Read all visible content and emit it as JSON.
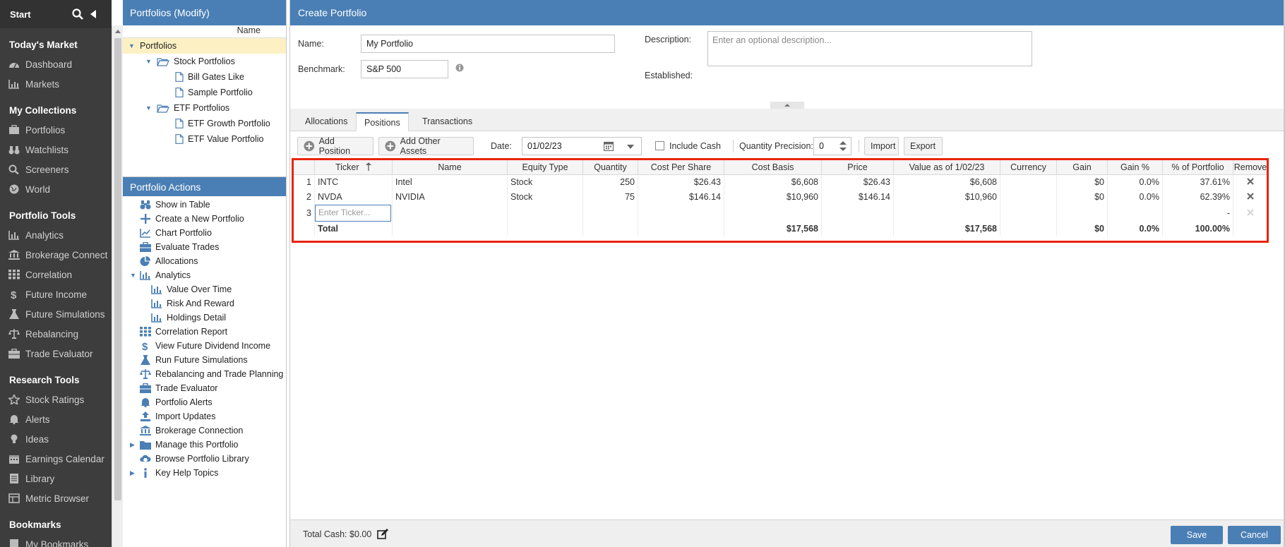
{
  "nav": {
    "start_label": "Start",
    "sections": [
      {
        "title": "Today's Market",
        "items": [
          {
            "label": "Dashboard",
            "icon": "dashboard-icon"
          },
          {
            "label": "Markets",
            "icon": "markets-icon"
          }
        ]
      },
      {
        "title": "My Collections",
        "items": [
          {
            "label": "Portfolios",
            "icon": "portfolios-icon"
          },
          {
            "label": "Watchlists",
            "icon": "watchlists-icon"
          },
          {
            "label": "Screeners",
            "icon": "screeners-icon"
          },
          {
            "label": "World",
            "icon": "world-icon"
          }
        ]
      },
      {
        "title": "Portfolio Tools",
        "items": [
          {
            "label": "Analytics",
            "icon": "analytics-icon"
          },
          {
            "label": "Brokerage Connect",
            "icon": "bank-icon"
          },
          {
            "label": "Correlation",
            "icon": "grid-icon"
          },
          {
            "label": "Future Income",
            "icon": "dollar-icon"
          },
          {
            "label": "Future Simulations",
            "icon": "flask-icon"
          },
          {
            "label": "Rebalancing",
            "icon": "scale-icon"
          },
          {
            "label": "Trade Evaluator",
            "icon": "briefcase-icon"
          }
        ]
      },
      {
        "title": "Research Tools",
        "items": [
          {
            "label": "Stock Ratings",
            "icon": "star-icon"
          },
          {
            "label": "Alerts",
            "icon": "bell-icon"
          },
          {
            "label": "Ideas",
            "icon": "bulb-icon"
          },
          {
            "label": "Earnings Calendar",
            "icon": "calendar-icon"
          },
          {
            "label": "Library",
            "icon": "library-icon"
          },
          {
            "label": "Metric Browser",
            "icon": "metric-icon"
          }
        ]
      },
      {
        "title": "Bookmarks",
        "items": [
          {
            "label": "My Bookmarks",
            "icon": "bookmark-icon"
          }
        ]
      }
    ]
  },
  "tree": {
    "title": "Portfolios (Modify)",
    "column": "Name",
    "nodes": [
      {
        "label": "Portfolios",
        "level": 0,
        "type": "root",
        "selected": true
      },
      {
        "label": "Stock Portfolios",
        "level": 1,
        "type": "folder"
      },
      {
        "label": "Bill Gates Like",
        "level": 2,
        "type": "file"
      },
      {
        "label": "Sample Portfolio",
        "level": 2,
        "type": "file"
      },
      {
        "label": "ETF Portfolios",
        "level": 1,
        "type": "folder"
      },
      {
        "label": "ETF Growth Portfolio",
        "level": 2,
        "type": "file"
      },
      {
        "label": "ETF Value Portfolio",
        "level": 2,
        "type": "file"
      }
    ]
  },
  "actions": {
    "title": "Portfolio Actions",
    "items": [
      {
        "label": "Show in Table",
        "icon": "binoculars-icon",
        "indent": 0
      },
      {
        "label": "Create a New Portfolio",
        "icon": "plus-icon",
        "indent": 0
      },
      {
        "label": "Chart Portfolio",
        "icon": "line-chart-icon",
        "indent": 0
      },
      {
        "label": "Evaluate Trades",
        "icon": "briefcase-icon",
        "indent": 0
      },
      {
        "label": "Allocations",
        "icon": "pie-icon",
        "indent": 0
      },
      {
        "label": "Analytics",
        "icon": "analytics-icon",
        "indent": 0,
        "expanded": true
      },
      {
        "label": "Value Over Time",
        "icon": "bar-chart-icon",
        "indent": 1
      },
      {
        "label": "Risk And Reward",
        "icon": "bar-chart-icon",
        "indent": 1
      },
      {
        "label": "Holdings Detail",
        "icon": "bar-chart-icon",
        "indent": 1
      },
      {
        "label": "Correlation Report",
        "icon": "grid-icon",
        "indent": 0
      },
      {
        "label": "View Future Dividend Income",
        "icon": "dollar-icon",
        "indent": 0
      },
      {
        "label": "Run Future Simulations",
        "icon": "flask-icon",
        "indent": 0
      },
      {
        "label": "Rebalancing and Trade Planning",
        "icon": "scale-icon",
        "indent": 0
      },
      {
        "label": "Trade Evaluator",
        "icon": "briefcase-icon",
        "indent": 0
      },
      {
        "label": "Portfolio Alerts",
        "icon": "bell-icon",
        "indent": 0
      },
      {
        "label": "Import Updates",
        "icon": "upload-icon",
        "indent": 0
      },
      {
        "label": "Brokerage Connection",
        "icon": "bank-icon",
        "indent": 0
      },
      {
        "label": "Manage this Portfolio",
        "icon": "folder-icon",
        "indent": 0,
        "collapsed": true
      },
      {
        "label": "Browse Portfolio Library",
        "icon": "cloud-download-icon",
        "indent": 0
      },
      {
        "label": "Key Help Topics",
        "icon": "info-icon",
        "indent": 0,
        "collapsed": true
      }
    ]
  },
  "form": {
    "title": "Create Portfolio",
    "name_label": "Name:",
    "name_value": "My Portfolio",
    "benchmark_label": "Benchmark:",
    "benchmark_value": "S&P 500",
    "description_label": "Description:",
    "description_placeholder": "Enter an optional description...",
    "established_label": "Established:"
  },
  "tabs": [
    "Allocations",
    "Positions",
    "Transactions"
  ],
  "active_tab": "Positions",
  "toolbar": {
    "add_position": "Add Position",
    "add_other": "Add Other Assets",
    "date_label": "Date:",
    "date_value": "01/02/23",
    "include_cash": "Include Cash",
    "precision_label": "Quantity Precision:",
    "precision_value": "0",
    "import": "Import",
    "export": "Export"
  },
  "table": {
    "columns": [
      "",
      "Ticker",
      "Name",
      "Equity Type",
      "Quantity",
      "Cost Per Share",
      "Cost Basis",
      "Price",
      "Value as of 1/02/23",
      "Currency",
      "Gain",
      "Gain %",
      "% of Portfolio",
      "Remove"
    ],
    "rows": [
      {
        "n": "1",
        "ticker": "INTC",
        "name": "Intel",
        "type": "Stock",
        "qty": "250",
        "cps": "$26.43",
        "basis": "$6,608",
        "price": "$26.43",
        "value": "$6,608",
        "currency": "",
        "gain": "$0",
        "gain_pct": "0.0%",
        "pct": "37.61%"
      },
      {
        "n": "2",
        "ticker": "NVDA",
        "name": "NVIDIA",
        "type": "Stock",
        "qty": "75",
        "cps": "$146.14",
        "basis": "$10,960",
        "price": "$146.14",
        "value": "$10,960",
        "currency": "",
        "gain": "$0",
        "gain_pct": "0.0%",
        "pct": "62.39%"
      }
    ],
    "new_row": {
      "n": "3",
      "placeholder": "Enter Ticker...",
      "pct": "-"
    },
    "total": {
      "label": "Total",
      "basis": "$17,568",
      "value": "$17,568",
      "gain": "$0",
      "gain_pct": "0.0%",
      "pct": "100.00%"
    }
  },
  "footer": {
    "total_cash": "Total Cash: $0.00",
    "save": "Save",
    "cancel": "Cancel"
  },
  "colors": {
    "accent": "#4a7fb5",
    "highlight": "#e8240f",
    "nav_bg": "#3d3d3d"
  }
}
